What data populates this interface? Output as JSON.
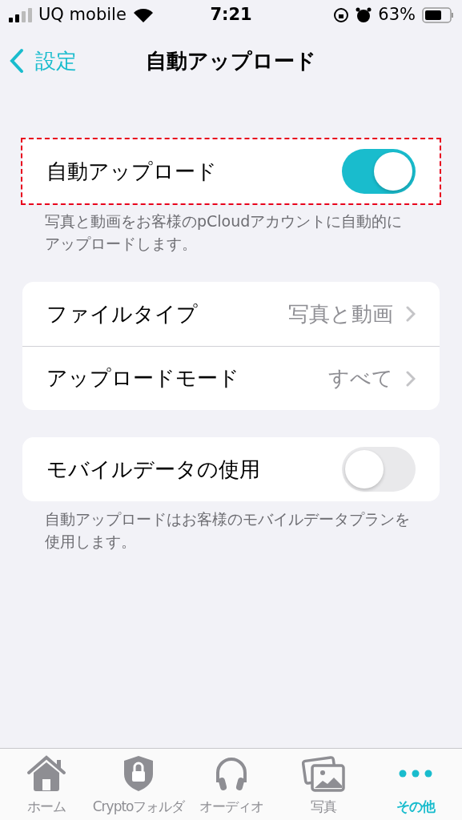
{
  "status_bar": {
    "carrier": "UQ mobile",
    "time": "7:21",
    "battery": "63%"
  },
  "nav": {
    "back": "設定",
    "title": "自動アップロード"
  },
  "sections": [
    {
      "highlighted": true,
      "rows": [
        {
          "kind": "toggle",
          "label": "自動アップロード",
          "on": true
        }
      ],
      "footer": "写真と動画をお客様のpCloudアカウントに自動的にアップロードします。"
    },
    {
      "highlighted": false,
      "rows": [
        {
          "kind": "link",
          "label": "ファイルタイプ",
          "value": "写真と動画"
        },
        {
          "kind": "link",
          "label": "アップロードモード",
          "value": "すべて"
        }
      ]
    },
    {
      "highlighted": false,
      "rows": [
        {
          "kind": "toggle",
          "label": "モバイルデータの使用",
          "on": false
        }
      ],
      "footer": "自動アップロードはお客様のモバイルデータプランを使用します。"
    }
  ],
  "tab_bar": [
    {
      "label": "ホーム",
      "selected": false
    },
    {
      "label": "Cryptoフォルダ",
      "selected": false
    },
    {
      "label": "オーディオ",
      "selected": false
    },
    {
      "label": "写真",
      "selected": false
    },
    {
      "label": "その他",
      "selected": true
    }
  ]
}
